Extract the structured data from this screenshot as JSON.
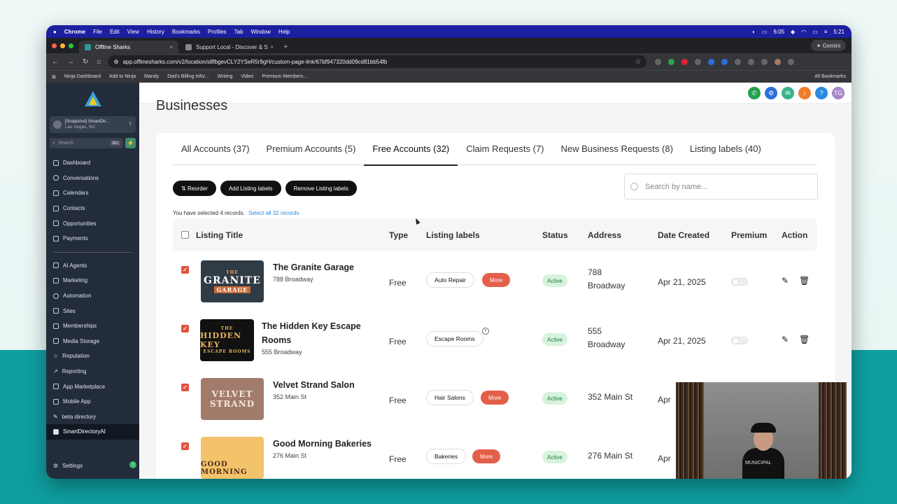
{
  "mac_menu": {
    "apple": "",
    "items": [
      "Chrome",
      "File",
      "Edit",
      "View",
      "History",
      "Bookmarks",
      "Profiles",
      "Tab",
      "Window",
      "Help"
    ],
    "status": [
      "6:05",
      "21",
      "5:21"
    ]
  },
  "browser": {
    "tabs": [
      {
        "title": "Offline Sharks",
        "close": "×"
      },
      {
        "title": "Support Local - Discover & S",
        "close": "×"
      }
    ],
    "new_tab": "+",
    "gemini": "Gemini",
    "url": "app.offlinesharks.com/v2/location/s8fbgevCLY2YSeR5r9gH/custom-page-link/67bf947320dd09cd81bb54fb",
    "bookmarks": [
      "Ninja Dashboard",
      "Add to Ninja",
      "Mandy",
      "Dad's Billing Info/...",
      "Writing",
      "Video",
      "Premium Members..."
    ],
    "all_bookmarks": "All Bookmarks"
  },
  "sidebar": {
    "account_name": "[Snapshot] SmartDir...",
    "account_location": "Las Vegas, NV",
    "search_placeholder": "Search",
    "search_shortcut": "⌘K",
    "items": [
      "Dashboard",
      "Conversations",
      "Calendars",
      "Contacts",
      "Opportunities",
      "Payments"
    ],
    "items2": [
      "AI Agents",
      "Marketing",
      "Automation",
      "Sites",
      "Memberships",
      "Media Storage",
      "Reputation",
      "Reporting",
      "App Marketplace",
      "Mobile App",
      "beta directory",
      "SmartDirectoryAI"
    ],
    "settings": "Settings"
  },
  "header_icons": {
    "avatar": "TG",
    "help": "?"
  },
  "page_title": "Businesses",
  "tabs": [
    "All Accounts (37)",
    "Premium Accounts (5)",
    "Free Accounts (32)",
    "Claim Requests (7)",
    "New Business Requests (8)",
    "Listing labels (40)"
  ],
  "buttons": {
    "reorder": "Reorder",
    "add_labels": "Add Listing labels",
    "remove_labels": "Remove Listing labels"
  },
  "search": {
    "placeholder": "Search by name..."
  },
  "selection": {
    "text": "You have selected 4 records.",
    "link": "Select all 32 records"
  },
  "columns": [
    "Listing Title",
    "Type",
    "Listing labels",
    "Status",
    "Address",
    "Date Created",
    "Premium",
    "Action"
  ],
  "rows": [
    {
      "name": "The Granite Garage",
      "address": "788 Broadway",
      "type": "Free",
      "label": "Auto Repair",
      "more": "More",
      "status": "Active",
      "addr1": "788",
      "addr2": "Broadway",
      "date": "Apr 21, 2025",
      "thumb_top": "THE",
      "thumb_main": "GRANITE",
      "thumb_sub": "GARAGE"
    },
    {
      "name": "The Hidden Key Escape",
      "name2": "Rooms",
      "address": "555 Broadway",
      "type": "Free",
      "label": "Escape Rooms",
      "status": "Active",
      "addr1": "555",
      "addr2": "Broadway",
      "date": "Apr 21, 2025",
      "thumb_top": "THE",
      "thumb_main": "HIDDEN KEY",
      "thumb_sub": "ESCAPE ROOMS"
    },
    {
      "name": "Velvet Strand Salon",
      "address": "352 Main St",
      "type": "Free",
      "label": "Hair Salons",
      "more": "More",
      "status": "Active",
      "addr1": "352 Main St",
      "date": "Apr",
      "thumb_main": "VELVET",
      "thumb_sub": "STRAND"
    },
    {
      "name": "Good Morning Bakeries",
      "address": "276 Main St",
      "type": "Free",
      "label": "Bakeries",
      "more": "More",
      "status": "Active",
      "addr1": "276 Main St",
      "date": "Apr",
      "thumb_main": "GOOD MORNING"
    }
  ],
  "webcam_text": "MUNICIPAL",
  "colors": {
    "mac_bar": "#1c1fa0",
    "sidebar": "#232c3b",
    "accent": "#e35f4a",
    "status_bg": "#d7f3dd",
    "background_bottom": "#0f9ea0"
  }
}
